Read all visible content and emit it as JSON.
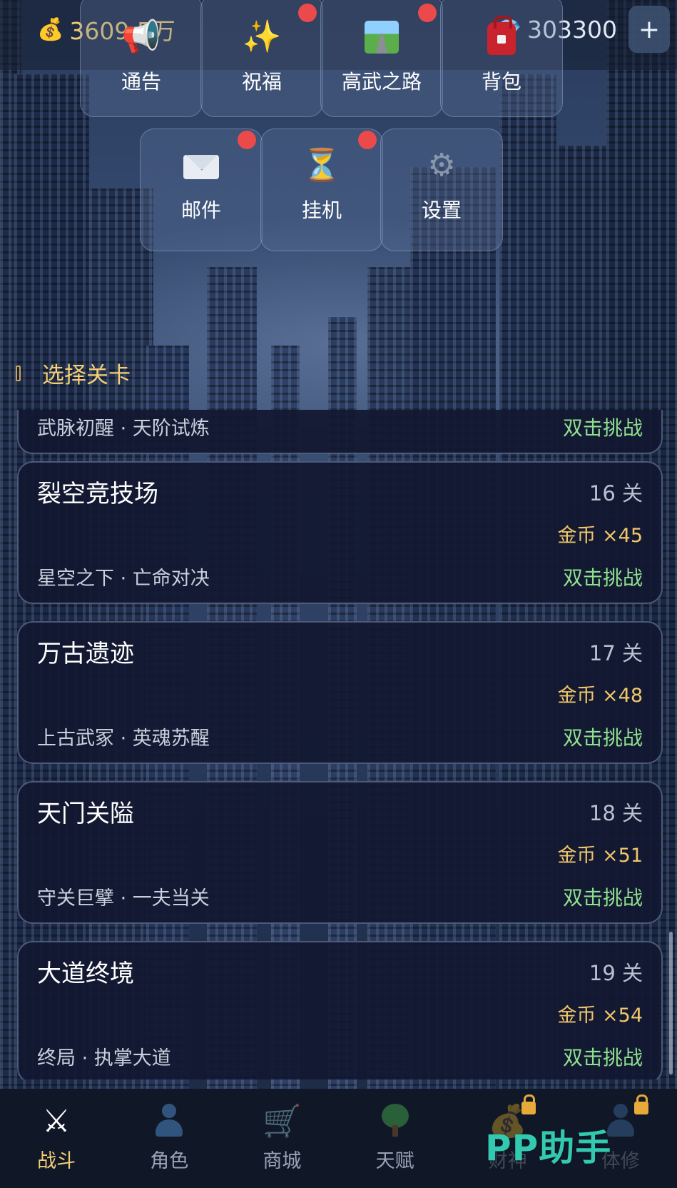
{
  "resources": {
    "gold": "3609.5万",
    "gems": "303300",
    "gold_icon": "money-bag-icon",
    "gem_icon": "diamond-icon"
  },
  "menu": [
    {
      "label": "通告",
      "icon": "megaphone-icon",
      "badge": false
    },
    {
      "label": "祝福",
      "icon": "sparkles-icon",
      "badge": true
    },
    {
      "label": "高武之路",
      "icon": "road-icon",
      "badge": true
    },
    {
      "label": "背包",
      "icon": "backpack-icon",
      "badge": false
    },
    {
      "label": "邮件",
      "icon": "mail-icon",
      "badge": true
    },
    {
      "label": "挂机",
      "icon": "hourglass-icon",
      "badge": true
    },
    {
      "label": "设置",
      "icon": "gear-icon",
      "badge": false
    }
  ],
  "section_title": "选择关卡",
  "stages": [
    {
      "name": "",
      "level": "",
      "reward": "",
      "subtitle": "武脉初醒 · 天阶试炼",
      "action": "双击挑战"
    },
    {
      "name": "裂空竞技场",
      "level": "16 关",
      "reward": "金币 ×45",
      "subtitle": "星空之下 · 亡命对决",
      "action": "双击挑战"
    },
    {
      "name": "万古遗迹",
      "level": "17 关",
      "reward": "金币 ×48",
      "subtitle": "上古武冢 · 英魂苏醒",
      "action": "双击挑战"
    },
    {
      "name": "天门关隘",
      "level": "18 关",
      "reward": "金币 ×51",
      "subtitle": "守关巨擘 · 一夫当关",
      "action": "双击挑战"
    },
    {
      "name": "大道终境",
      "level": "19 关",
      "reward": "金币 ×54",
      "subtitle": "终局 · 执掌大道",
      "action": "双击挑战"
    }
  ],
  "nav": [
    {
      "label": "战斗",
      "icon": "crossed-swords-icon",
      "active": true,
      "locked": false
    },
    {
      "label": "角色",
      "icon": "person-icon",
      "active": false,
      "locked": false
    },
    {
      "label": "商城",
      "icon": "cart-icon",
      "active": false,
      "locked": false
    },
    {
      "label": "天赋",
      "icon": "tree-icon",
      "active": false,
      "locked": false
    },
    {
      "label": "财神",
      "icon": "money-bag-icon",
      "active": false,
      "locked": true
    },
    {
      "label": "体修",
      "icon": "person-icon",
      "active": false,
      "locked": true
    }
  ],
  "watermark": "PP助手",
  "colors": {
    "gold_text": "#f3cf74",
    "action_green": "#8fe08f",
    "badge_red": "#ea4a4a",
    "card_bg": "#121830"
  }
}
